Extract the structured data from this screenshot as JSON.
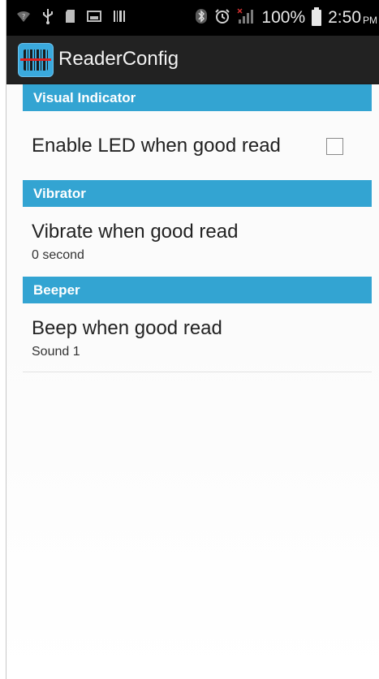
{
  "status_bar": {
    "battery_percent": "100%",
    "time": "2:50",
    "time_suffix": "PM",
    "icons": [
      "wifi-question-icon",
      "usb-icon",
      "sd-card-icon",
      "screenshot-icon",
      "barcode-icon",
      "bluetooth-icon",
      "alarm-icon",
      "signal-icon",
      "battery-icon"
    ]
  },
  "action_bar": {
    "title": "ReaderConfig",
    "icon": "barcode-scanner-app-icon"
  },
  "sections": {
    "visual": {
      "header": "Visual Indicator",
      "items": [
        {
          "title": "Enable LED when good read",
          "checked": false
        }
      ]
    },
    "vibrator": {
      "header": "Vibrator",
      "items": [
        {
          "title": "Vibrate when good read",
          "summary": "0 second"
        }
      ]
    },
    "beeper": {
      "header": "Beeper",
      "items": [
        {
          "title": "Beep when good read",
          "summary": "Sound 1"
        }
      ]
    }
  },
  "colors": {
    "accent": "#33a4d2",
    "action_bar": "#222222",
    "status_bar": "#000000"
  }
}
